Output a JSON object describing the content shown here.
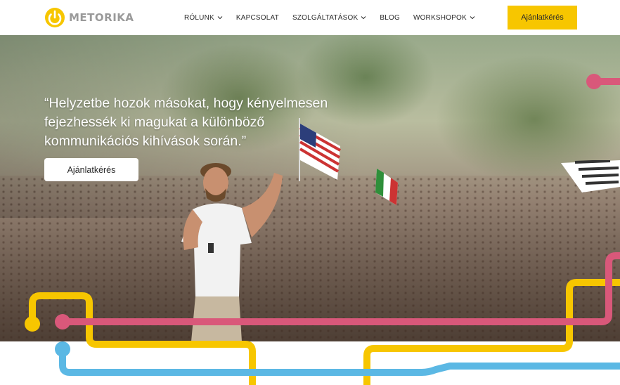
{
  "header": {
    "logo_text": "METORIKA",
    "nav": [
      {
        "label": "RÓLUNK",
        "dropdown": true
      },
      {
        "label": "KAPCSOLAT",
        "dropdown": false
      },
      {
        "label": "SZOLGÁLTATÁSOK",
        "dropdown": true
      },
      {
        "label": "BLOG",
        "dropdown": false
      },
      {
        "label": "WORKSHOPOK",
        "dropdown": true
      }
    ],
    "cta_label": "Ajánlatkérés"
  },
  "hero": {
    "quote": "“Helyzetbe hozok másokat, hogy kényelmesen fejezhessék ki magukat a különböző kommunikációs kihívások során.”",
    "button_label": "Ajánlatkérés"
  },
  "colors": {
    "accent_yellow": "#f7c600",
    "line_pink": "#d9587a",
    "line_blue": "#5bb8e4",
    "nav_text": "#2a2a2a"
  }
}
